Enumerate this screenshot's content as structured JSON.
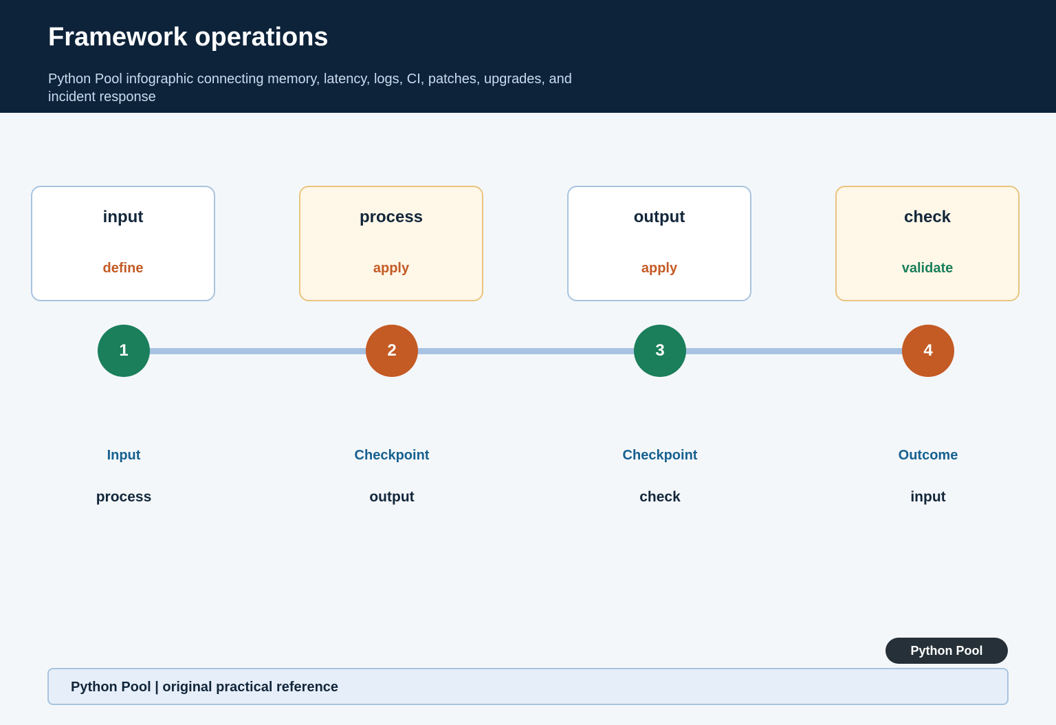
{
  "header": {
    "title": "Framework operations",
    "subtitle": "Python Pool infographic connecting memory, latency, logs, CI, patches, upgrades, and incident response"
  },
  "colors": {
    "header_bg": "#0d233a",
    "green": "#1a7f5a",
    "orange": "#c45a24",
    "connector": "#a8c3e2",
    "label_blue": "#16608f"
  },
  "cards": [
    {
      "title": "input",
      "subtitle": "define",
      "subtitle_color": "#c45a24",
      "style": "light"
    },
    {
      "title": "process",
      "subtitle": "apply",
      "subtitle_color": "#c45a24",
      "style": "warm"
    },
    {
      "title": "output",
      "subtitle": "apply",
      "subtitle_color": "#c45a24",
      "style": "light"
    },
    {
      "title": "check",
      "subtitle": "validate",
      "subtitle_color": "#1a7f5a",
      "style": "warm"
    }
  ],
  "steps": [
    {
      "number": "1",
      "color": "green",
      "label": "Input",
      "value": "process"
    },
    {
      "number": "2",
      "color": "orange",
      "label": "Checkpoint",
      "value": "output"
    },
    {
      "number": "3",
      "color": "green",
      "label": "Checkpoint",
      "value": "check"
    },
    {
      "number": "4",
      "color": "orange",
      "label": "Outcome",
      "value": "input"
    }
  ],
  "badge": {
    "label": "Python Pool"
  },
  "footer": {
    "text": "Python Pool | original practical reference"
  }
}
